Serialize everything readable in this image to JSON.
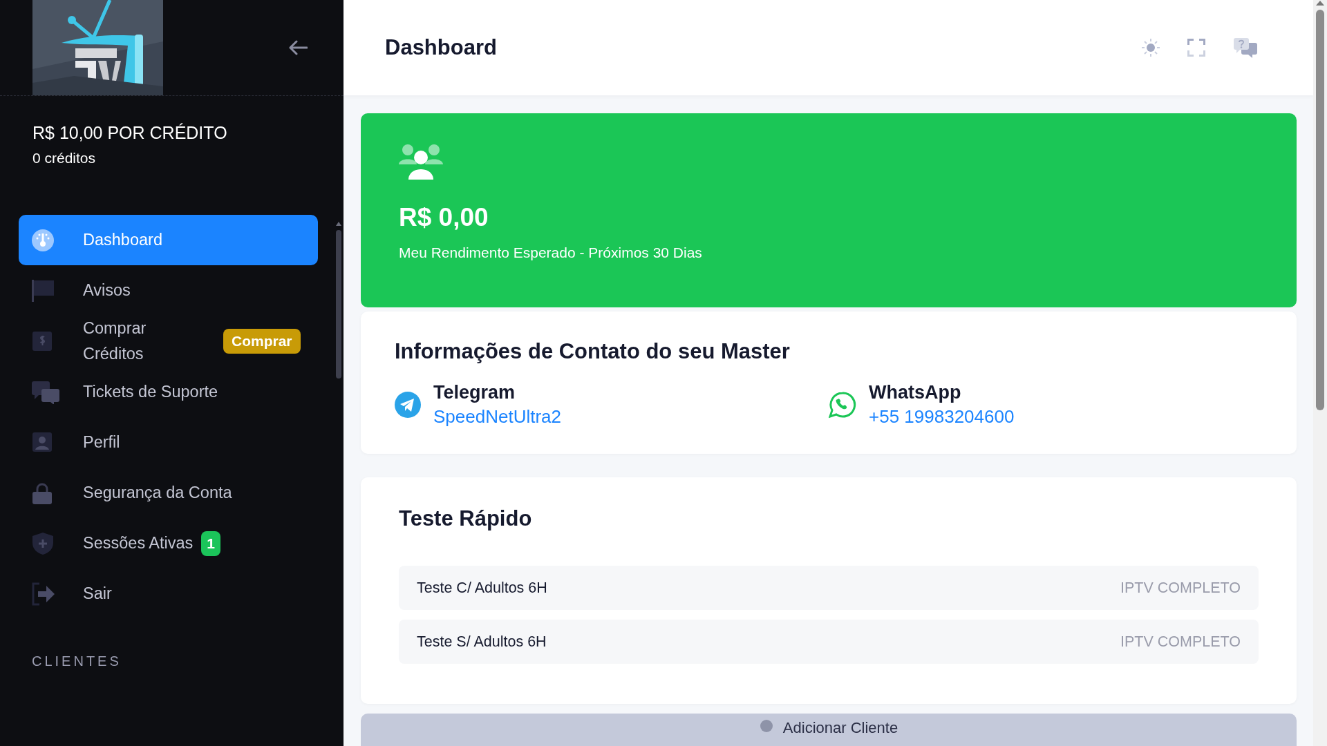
{
  "sidebar": {
    "price": "R$ 10,00 POR CRÉDITO",
    "credits": "0 créditos",
    "items": [
      {
        "label": "Dashboard",
        "selected": true
      },
      {
        "label": "Avisos",
        "selected": false
      },
      {
        "label": "Comprar Créditos",
        "selected": false,
        "badge": {
          "text": "Comprar",
          "color": "#c89b07"
        }
      },
      {
        "label": "Tickets de Suporte",
        "selected": false
      },
      {
        "label": "Perfil",
        "selected": false
      },
      {
        "label": "Segurança da Conta",
        "selected": false
      },
      {
        "label": "Sessões Ativas",
        "selected": false,
        "badge": {
          "text": "1",
          "color": "#1bc45a"
        }
      },
      {
        "label": "Sair",
        "selected": false
      }
    ],
    "section_title": "CLIENTES"
  },
  "header": {
    "title": "Dashboard"
  },
  "income_card": {
    "amount": "R$ 0,00",
    "caption": "Meu Rendimento Esperado - Próximos 30 Dias"
  },
  "contact_card": {
    "title": "Informações de Contato do seu Master",
    "contacts": [
      {
        "kind": "telegram",
        "name": "Telegram",
        "value": "SpeedNetUltra2"
      },
      {
        "kind": "whatsapp",
        "name": "WhatsApp",
        "value": "+55 19983204600"
      }
    ]
  },
  "quick_test": {
    "title": "Teste Rápido",
    "rows": [
      {
        "name": "Teste C/ Adultos 6H",
        "package": "IPTV COMPLETO"
      },
      {
        "name": "Teste S/ Adultos 6H",
        "package": "IPTV COMPLETO"
      }
    ]
  },
  "add_client_button": "Adicionar Cliente"
}
